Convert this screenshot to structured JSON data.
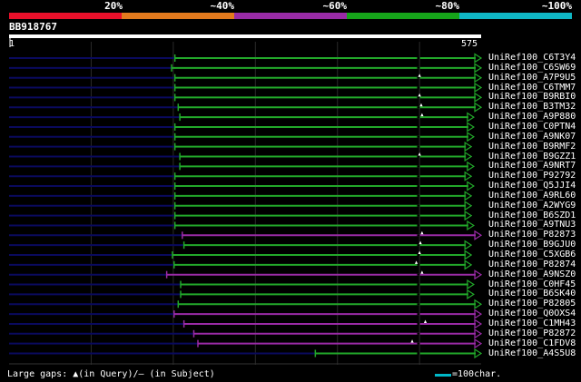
{
  "percent_bar": {
    "segments": [
      {
        "color": "#e8102a",
        "from": 0,
        "to": 20
      },
      {
        "color": "#e37a1d",
        "from": 20,
        "to": 40
      },
      {
        "color": "#992ba6",
        "from": 40,
        "to": 60
      },
      {
        "color": "#16a41a",
        "from": 60,
        "to": 80
      },
      {
        "color": "#0fb6c4",
        "from": 80,
        "to": 100
      }
    ],
    "labels": [
      "20%",
      "~40%",
      "~60%",
      "~80%",
      "~100%"
    ]
  },
  "query": {
    "id": "BB918767",
    "length": 575,
    "start_label": "1",
    "end_label": "575"
  },
  "colors": {
    "green": "#22a82a",
    "purple": "#9a2aa6",
    "navy": "#0a0a5e",
    "gap": "#ffffff"
  },
  "hits": [
    {
      "name": "UniRef100_C6T3Y4",
      "start": 202,
      "end": 575,
      "color": "green",
      "gap": 0
    },
    {
      "name": "UniRef100_C6SW69",
      "start": 198,
      "end": 575,
      "color": "green",
      "gap": 0
    },
    {
      "name": "UniRef100_A7P9U5",
      "start": 202,
      "end": 575,
      "color": "green",
      "gap": 500
    },
    {
      "name": "UniRef100_C6TMM7",
      "start": 202,
      "end": 575,
      "color": "green",
      "gap": 0
    },
    {
      "name": "UniRef100_B9RBI0",
      "start": 202,
      "end": 575,
      "color": "green",
      "gap": 500
    },
    {
      "name": "UniRef100_B3TM32",
      "start": 206,
      "end": 575,
      "color": "green",
      "gap": 502
    },
    {
      "name": "UniRef100_A9P880",
      "start": 208,
      "end": 566,
      "color": "green",
      "gap": 503
    },
    {
      "name": "UniRef100_C0PTN4",
      "start": 202,
      "end": 566,
      "color": "green",
      "gap": 0
    },
    {
      "name": "UniRef100_A9NK07",
      "start": 202,
      "end": 566,
      "color": "green",
      "gap": 0
    },
    {
      "name": "UniRef100_B9RMF2",
      "start": 202,
      "end": 563,
      "color": "green",
      "gap": 0
    },
    {
      "name": "UniRef100_B9GZZ1",
      "start": 208,
      "end": 563,
      "color": "green",
      "gap": 500
    },
    {
      "name": "UniRef100_A9NRT7",
      "start": 208,
      "end": 566,
      "color": "green",
      "gap": 0
    },
    {
      "name": "UniRef100_P92792",
      "start": 202,
      "end": 563,
      "color": "green",
      "gap": 0
    },
    {
      "name": "UniRef100_Q5JJI4",
      "start": 202,
      "end": 566,
      "color": "green",
      "gap": 0
    },
    {
      "name": "UniRef100_A9RL60",
      "start": 202,
      "end": 563,
      "color": "green",
      "gap": 0
    },
    {
      "name": "UniRef100_A2WYG9",
      "start": 202,
      "end": 563,
      "color": "green",
      "gap": 0
    },
    {
      "name": "UniRef100_B6SZD1",
      "start": 202,
      "end": 563,
      "color": "green",
      "gap": 0
    },
    {
      "name": "UniRef100_A9TNU3",
      "start": 202,
      "end": 566,
      "color": "green",
      "gap": 0
    },
    {
      "name": "UniRef100_P82873",
      "start": 211,
      "end": 575,
      "color": "purple",
      "gap": 503
    },
    {
      "name": "UniRef100_B9GJU0",
      "start": 213,
      "end": 563,
      "color": "green",
      "gap": 501
    },
    {
      "name": "UniRef100_C5XGB6",
      "start": 199,
      "end": 563,
      "color": "green",
      "gap": 500
    },
    {
      "name": "UniRef100_P82874",
      "start": 201,
      "end": 563,
      "color": "green",
      "gap": 496
    },
    {
      "name": "UniRef100_A9NSZ0",
      "start": 192,
      "end": 575,
      "color": "purple",
      "gap": 503
    },
    {
      "name": "UniRef100_C0HF45",
      "start": 209,
      "end": 566,
      "color": "green",
      "gap": 0
    },
    {
      "name": "UniRef100_B6SK40",
      "start": 209,
      "end": 566,
      "color": "green",
      "gap": 0
    },
    {
      "name": "UniRef100_P82805",
      "start": 206,
      "end": 575,
      "color": "green",
      "gap": 0
    },
    {
      "name": "UniRef100_Q0OXS4",
      "start": 201,
      "end": 575,
      "color": "purple",
      "gap": 0
    },
    {
      "name": "UniRef100_C1MH43",
      "start": 213,
      "end": 575,
      "color": "purple",
      "gap": 507
    },
    {
      "name": "UniRef100_P82872",
      "start": 225,
      "end": 575,
      "color": "purple",
      "gap": 0
    },
    {
      "name": "UniRef100_C1FDV8",
      "start": 230,
      "end": 575,
      "color": "purple",
      "gap": 491
    },
    {
      "name": "UniRef100_A4S5U8",
      "start": 373,
      "end": 575,
      "color": "green",
      "gap": 0
    }
  ],
  "legend": {
    "text": "Large gaps: ▲(in Query)/– (in Subject)",
    "scale_label": "=100char."
  }
}
